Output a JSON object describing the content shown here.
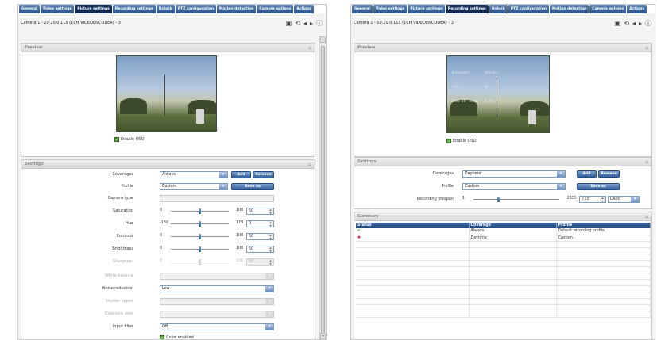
{
  "left": {
    "tabs": [
      {
        "label": "General",
        "active": false
      },
      {
        "label": "Video settings",
        "active": false
      },
      {
        "label": "Picture settings",
        "active": true
      },
      {
        "label": "Recording settings",
        "active": false
      },
      {
        "label": "Unlock",
        "active": false
      },
      {
        "label": "PTZ configuration",
        "active": false
      },
      {
        "label": "Motion detection",
        "active": false
      },
      {
        "label": "Camera options",
        "active": false
      },
      {
        "label": "Actions",
        "active": false
      }
    ],
    "camera_title": "Camera 1 - 10.20.0.115 (1CH VIDEOENCODER) - 3",
    "preview_title": "Preview",
    "enable_osd": "Enable OSD",
    "settings_title": "Settings",
    "coverages_label": "Coverages",
    "coverages_value": "Always",
    "add_button": "Add",
    "remove_button": "Remove",
    "profile_label": "Profile",
    "profile_value": "Custom",
    "save_as_button": "Save as",
    "camera_type_label": "Camera type",
    "sliders": [
      {
        "label": "Saturation",
        "min": "0",
        "max": "100",
        "value": "50",
        "fraction": 0.5,
        "disabled": false
      },
      {
        "label": "Hue",
        "min": "-180",
        "max": "179",
        "value": "0",
        "fraction": 0.5,
        "disabled": false
      },
      {
        "label": "Contrast",
        "min": "0",
        "max": "100",
        "value": "50",
        "fraction": 0.5,
        "disabled": false
      },
      {
        "label": "Brightness",
        "min": "0",
        "max": "100",
        "value": "50",
        "fraction": 0.5,
        "disabled": false
      },
      {
        "label": "Sharpness",
        "min": "0",
        "max": "100",
        "value": "50",
        "fraction": 0.5,
        "disabled": true
      }
    ],
    "white_balance_label": "White balance",
    "noise_reduction_label": "Noise reduction",
    "noise_reduction_value": "Low",
    "shutter_speed_label": "Shutter speed",
    "exposure_area_label": "Exposure area",
    "input_filter_label": "Input filter",
    "input_filter_value": "Off",
    "color_enabled": "Color enabled"
  },
  "right": {
    "tabs": [
      {
        "label": "General",
        "active": false
      },
      {
        "label": "Video settings",
        "active": false
      },
      {
        "label": "Picture settings",
        "active": false
      },
      {
        "label": "Recording settings",
        "active": true
      },
      {
        "label": "Unlock",
        "active": false
      },
      {
        "label": "PTZ configuration",
        "active": false
      },
      {
        "label": "Motion detection",
        "active": false
      },
      {
        "label": "Camera options",
        "active": false
      },
      {
        "label": "Actions",
        "active": false
      }
    ],
    "camera_title": "Camera 1 - 10.20.0.115 (1CH VIDEOENCODER) - 3",
    "preview_title": "Preview",
    "osd_lines": [
      "Bandwidth:       905kb/s",
      "FPS:             30",
      "Rate at  Codec:  H.264"
    ],
    "enable_osd": "Enable OSD",
    "settings_title": "Settings",
    "coverages_label": "Coverages",
    "coverages_value": "Daytime",
    "add_button": "Add",
    "remove_button": "Remove",
    "profile_label": "Profile",
    "profile_value": "Custom",
    "save_as_button": "Save as",
    "lifespan_label": "Recording lifespan",
    "lifespan_min": "1",
    "lifespan_max": "2555",
    "lifespan_value": "733",
    "lifespan_fraction": 0.29,
    "lifespan_unit": "Days",
    "summary_title": "Summary",
    "summary_headers": [
      "Status",
      "Coverage",
      "Profile"
    ],
    "summary_rows": [
      {
        "status": "ok",
        "status_glyph": "✔",
        "coverage": "Always",
        "profile": "Default recording profile"
      },
      {
        "status": "error",
        "status_glyph": "✖",
        "coverage": "Daytime",
        "profile": "Custom"
      }
    ],
    "empty_rows": 12
  }
}
